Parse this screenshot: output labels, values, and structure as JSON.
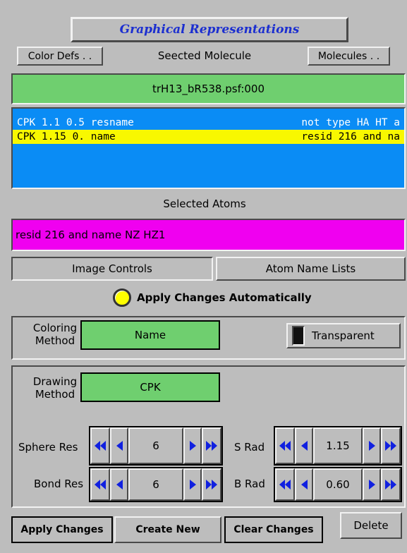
{
  "window": {
    "title": "Graphical Representations"
  },
  "top_buttons": {
    "color_defs": "Color Defs . .",
    "molecules": "Molecules . ."
  },
  "selected_molecule": {
    "label": "Seected Molecule",
    "value": "trH13_bR538.psf:000"
  },
  "rep_list": {
    "rows": [
      {
        "style": "CPK 1.1 0.5",
        "color": "resname",
        "selection": "not type HA HT a"
      },
      {
        "style": "CPK 1.15 0.",
        "color": "name",
        "selection": "resid 216 and na"
      }
    ]
  },
  "selected_atoms": {
    "label": "Selected Atoms",
    "value": "resid 216 and name NZ HZ1"
  },
  "tabs": {
    "image_controls": "Image Controls",
    "atom_name_lists": "Atom Name Lists"
  },
  "apply_auto": {
    "label": "Apply Changes Automatically"
  },
  "coloring": {
    "label_line1": "Coloring",
    "label_line2": "Method",
    "value": "Name",
    "transparent_label": "Transparent"
  },
  "drawing": {
    "label_line1": "Drawing",
    "label_line2": "Method",
    "value": "CPK"
  },
  "params": {
    "sphere_res": {
      "label": "Sphere Res",
      "value": "6"
    },
    "bond_res": {
      "label": "Bond Res",
      "value": "6"
    },
    "s_rad": {
      "label": "S Rad",
      "value": "1.15"
    },
    "b_rad": {
      "label": "B Rad",
      "value": "0.60"
    }
  },
  "bottom_buttons": {
    "apply": "Apply Changes",
    "create": "Create New",
    "clear": "Clear Changes",
    "delete": "Delete"
  },
  "colors": {
    "panel": "#bdbdbd",
    "green": "#6fcf6f",
    "list_blue": "#0a8cf5",
    "list_yellow": "#f8f800",
    "magenta": "#f000f0",
    "title_blue": "#1c2fd0",
    "arrow_blue": "#1020e0"
  }
}
